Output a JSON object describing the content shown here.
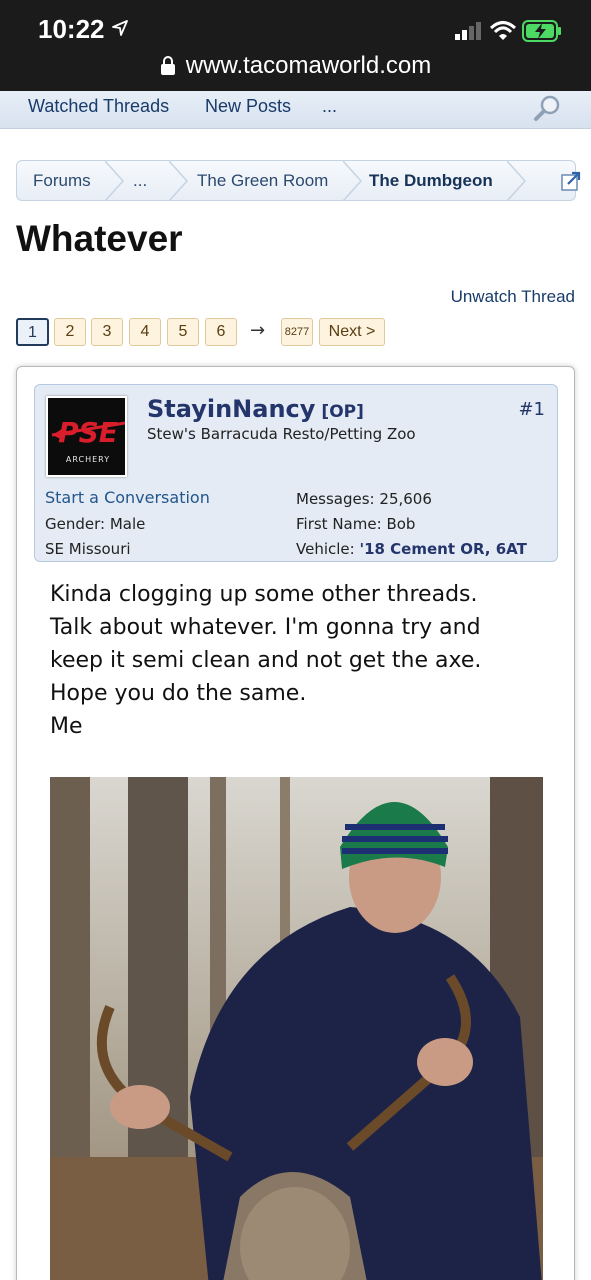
{
  "status": {
    "time": "10:22",
    "url": "www.tacomaworld.com"
  },
  "nav": {
    "watched": "Watched Threads",
    "new_posts": "New Posts",
    "more": "..."
  },
  "breadcrumb": {
    "forums": "Forums",
    "ellipsis": "...",
    "green_room": "The Green Room",
    "dumbgeon": "The Dumbgeon"
  },
  "page_title": "Whatever",
  "unwatch": "Unwatch Thread",
  "pagination": {
    "pages": [
      "1",
      "2",
      "3",
      "4",
      "5",
      "6"
    ],
    "arrow": "→",
    "last": "8277",
    "next": "Next >"
  },
  "post": {
    "username": "StayinNancy",
    "op": "[OP]",
    "number": "#1",
    "user_title": "Stew's Barracuda Resto/Petting Zoo",
    "start_convo": "Start a Conversation",
    "gender_label": "Gender:",
    "gender": "Male",
    "location": "SE Missouri",
    "messages_label": "Messages:",
    "messages": "25,606",
    "firstname_label": "First Name:",
    "firstname": "Bob",
    "vehicle_label": "Vehicle:",
    "vehicle": "'18 Cement OR, 6AT",
    "avatar_text": "PSE",
    "avatar_sub": "ARCHERY",
    "message_lines": [
      "Kinda clogging up some other threads.",
      "Talk about whatever. I'm gonna try and",
      "keep it semi clean and not get the axe.",
      "Hope you do the same.",
      "Me"
    ]
  }
}
